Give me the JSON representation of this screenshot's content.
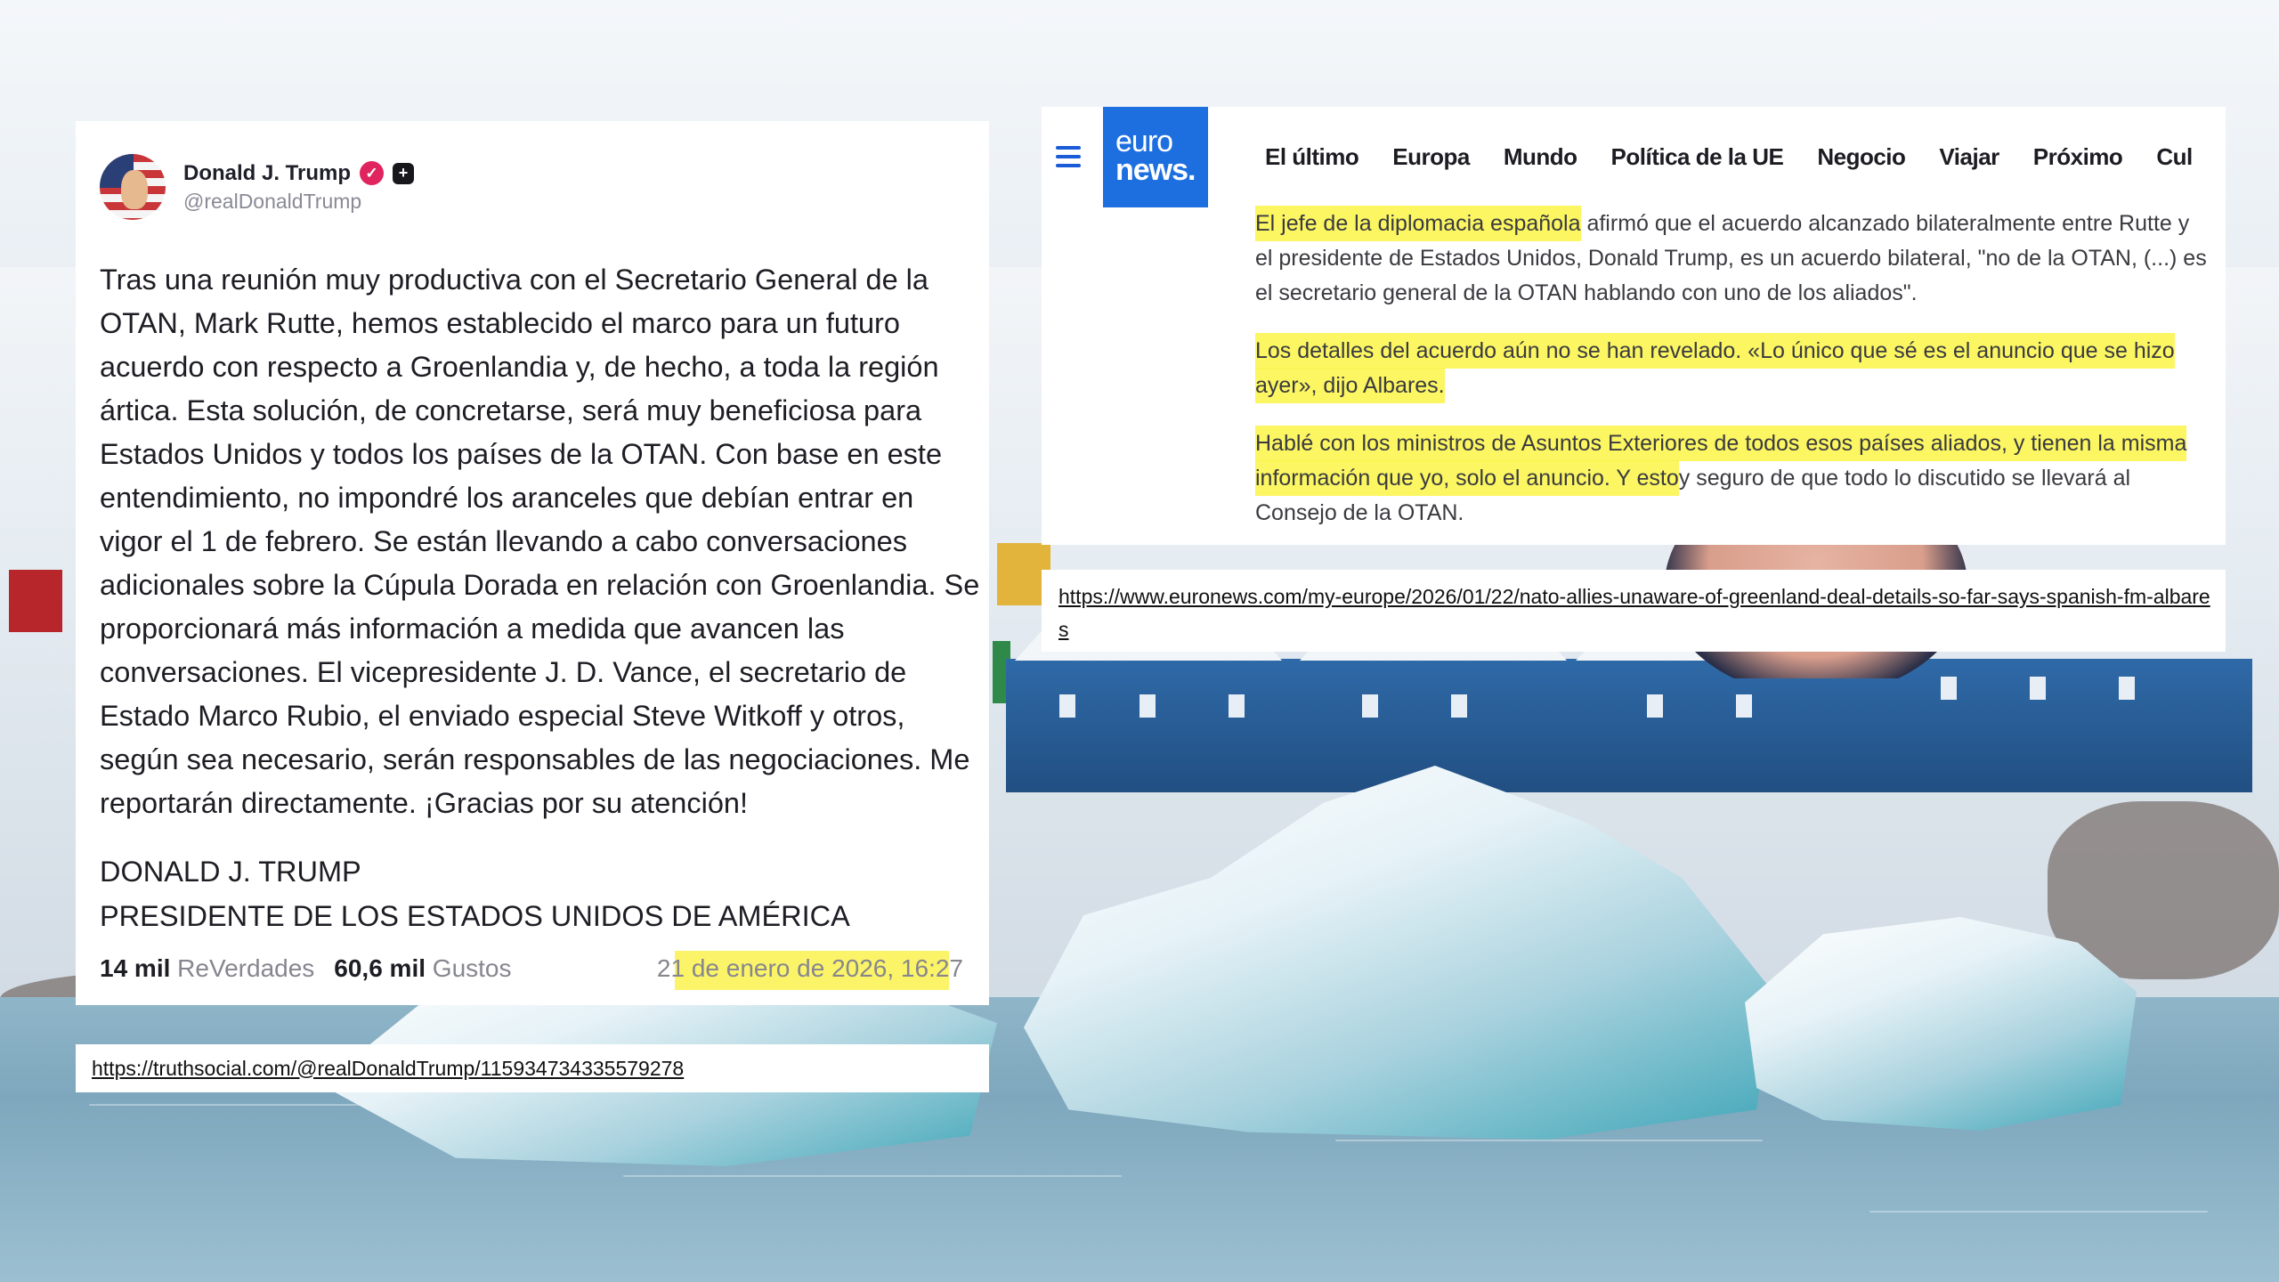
{
  "truth": {
    "display_name": "Donald J. Trump",
    "verified_glyph": "✓",
    "plus_glyph": "+",
    "handle": "@realDonaldTrump",
    "body": "Tras una reunión muy productiva con el Secretario General de la OTAN, Mark Rutte, hemos establecido el marco para un futuro acuerdo con respecto a Groenlandia y, de hecho, a toda la región ártica. Esta solución, de concretarse, será muy beneficiosa para Estados Unidos y todos los países de la OTAN. Con base en este entendimiento, no impondré los aranceles que debían entrar en vigor el 1 de febrero. Se están llevando a cabo conversaciones adicionales sobre la Cúpula Dorada en relación con Groenlandia. Se proporcionará más información a medida que avancen las conversaciones. El vicepresidente J. D. Vance, el secretario de Estado Marco Rubio, el enviado especial Steve Witkoff y otros, según sea necesario, serán responsables de las negociaciones. Me reportarán directamente. ¡Gracias por su atención!",
    "signature_line1": "DONALD J. TRUMP",
    "signature_line2": "PRESIDENTE DE LOS ESTADOS UNIDOS DE AMÉRICA",
    "retruths_count": "14 mil",
    "retruths_label": "ReVerdades",
    "likes_count": "60,6 mil",
    "likes_label": "Gustos",
    "date": "21 de enero de 2026, 16:27",
    "source_url": "https://truthsocial.com/@realDonaldTrump/115934734335579278"
  },
  "euronews": {
    "logo_line1": "euro",
    "logo_line2": "news.",
    "nav": [
      "El último",
      "Europa",
      "Mundo",
      "Política de la UE",
      "Negocio",
      "Viajar",
      "Próximo",
      "Cul"
    ],
    "p1_highlight": "El jefe de la diplomacia española",
    "p1_rest": " afirmó que el acuerdo alcanzado bilateralmente entre Rutte y el presidente de Estados Unidos, Donald Trump, es un acuerdo bilateral, \"no de la OTAN, (...) es el secretario general de la OTAN hablando con uno de los aliados\".",
    "p2_highlight": "Los detalles del acuerdo aún no se han revelado. «Lo único que sé es el anuncio que se hizo ayer», dijo Albares.",
    "p3_highlight": "Hablé con los ministros de Asuntos Exteriores de todos esos países aliados, y tienen la misma información que yo, solo el anuncio. Y esto",
    "p3_rest": "y seguro de que todo lo discutido se llevará al Consejo de la OTAN.",
    "source_url": "https://www.euronews.com/my-europe/2026/01/22/nato-allies-unaware-of-greenland-deal-details-so-far-says-spanish-fm-albares"
  },
  "colors": {
    "highlight": "#fbf24d",
    "euronews_blue": "#1d6fe0",
    "verified": "#e0245e"
  },
  "icons": [
    "menu-icon",
    "verified-icon",
    "plus-icon"
  ]
}
